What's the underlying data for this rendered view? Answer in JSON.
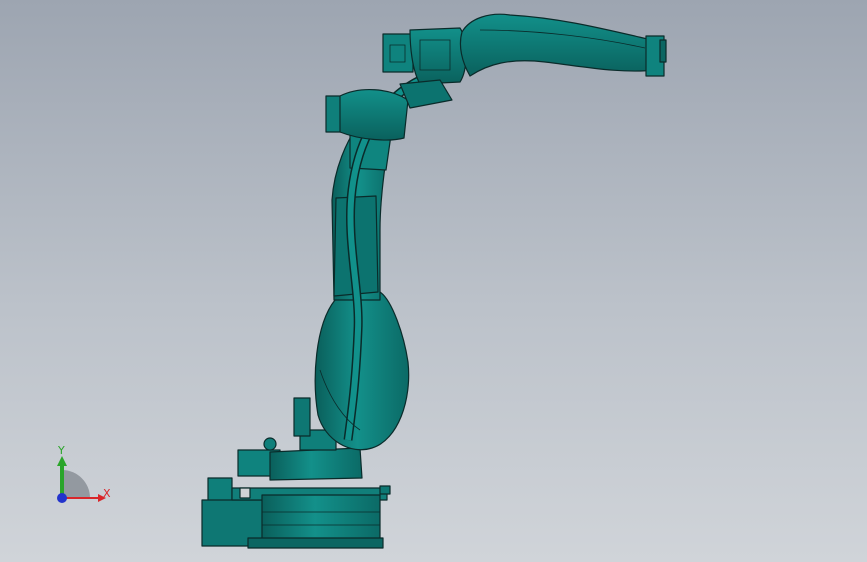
{
  "viewport": {
    "background_top": "#9da5b1",
    "background_bottom": "#d0d4d9"
  },
  "model": {
    "type": "six-axis industrial robot arm",
    "color": "#0e7f7a",
    "outline_color": "#0a2b2a"
  },
  "triad": {
    "x_label": "X",
    "y_label": "Y",
    "x_color": "#d9262a",
    "y_color": "#2aa52a",
    "z_color": "#2233cc"
  }
}
